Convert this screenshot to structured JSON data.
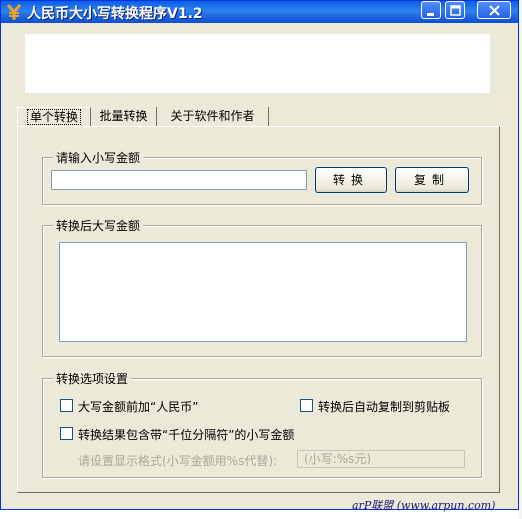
{
  "window": {
    "title": "人民币大小写转换程序V1.2",
    "accent_color": "#0a5fe8"
  },
  "tabs": [
    {
      "label": "单个转换",
      "active": true
    },
    {
      "label": "批量转换",
      "active": false
    },
    {
      "label": "关于软件和作者",
      "active": false
    }
  ],
  "input_group": {
    "label": "请输入小写金额",
    "value": "",
    "convert_label": "转换",
    "copy_label": "复制"
  },
  "output_group": {
    "label": "转换后大写金额",
    "value": ""
  },
  "options_group": {
    "label": "转换选项设置",
    "prefix_rmb_label": "大写金额前加“人民币”",
    "prefix_rmb_checked": false,
    "auto_copy_label": "转换后自动复制到剪贴板",
    "auto_copy_checked": false,
    "include_separator_label": "转换结果包含带“千位分隔符”的小写金额",
    "include_separator_checked": false,
    "format_label": "请设置显示格式(小写金额用%s代替):",
    "format_value": "(小写:%s元)"
  },
  "watermark": "arP联盟 (www.arpun.com)"
}
